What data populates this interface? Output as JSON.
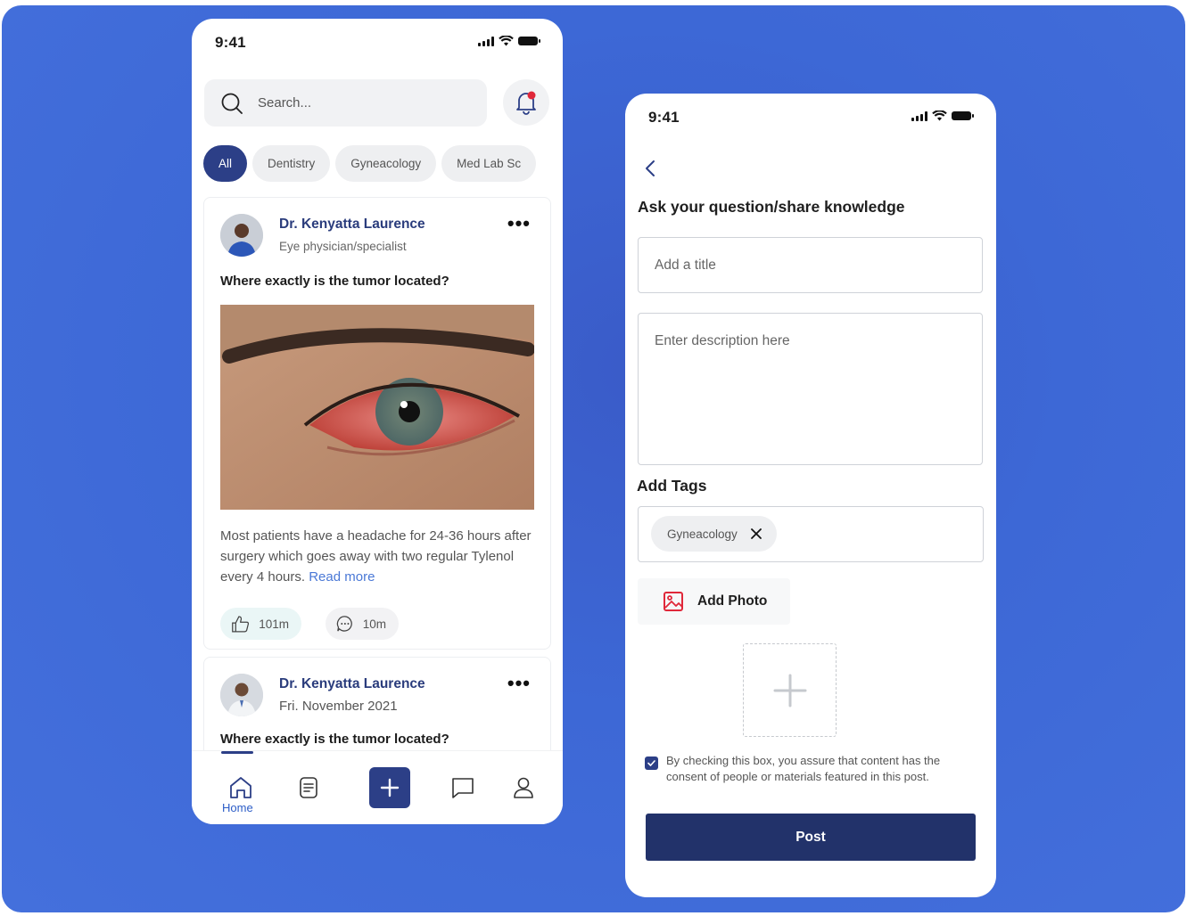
{
  "left_screen": {
    "status": {
      "time": "9:41"
    },
    "search": {
      "placeholder": "Search..."
    },
    "filters": [
      "All",
      "Dentistry",
      "Gyneacology",
      "Med Lab Sc"
    ],
    "posts": [
      {
        "author": "Dr. Kenyatta Laurence",
        "subtitle": "Eye physician/specialist",
        "title": "Where exactly is the tumor located?",
        "body": "Most patients have a headache for 24-36 hours after surgery which goes away with two regular Tylenol every 4 hours.",
        "read_more": "Read more",
        "likes": "101m",
        "comments": "10m"
      },
      {
        "author": "Dr. Kenyatta Laurence",
        "subtitle": "Fri. November 2021",
        "title": "Where exactly is the tumor located?"
      }
    ],
    "nav": {
      "home_label": "Home"
    }
  },
  "right_screen": {
    "status": {
      "time": "9:41"
    },
    "heading": "Ask your question/share knowledge",
    "title_placeholder": "Add a title",
    "description_placeholder": "Enter description here",
    "tags_label": "Add Tags",
    "tags": [
      "Gyneacology"
    ],
    "add_photo_label": "Add Photo",
    "consent_text": "By checking this box, you assure that content has the consent of people or materials featured in this post.",
    "post_button": "Post"
  },
  "colors": {
    "background": "#3d68d6",
    "primary": "#2c3f87",
    "post_button": "#22326a",
    "link": "#4a78d6",
    "notification_dot": "#e0283a",
    "add_photo_icon": "#e0283a"
  },
  "icons": [
    "search-icon",
    "bell-icon",
    "more-icon",
    "like-icon",
    "comment-icon",
    "home-icon",
    "notes-icon",
    "plus-icon",
    "chat-icon",
    "profile-icon",
    "back-icon",
    "close-icon",
    "image-icon",
    "check-icon"
  ]
}
